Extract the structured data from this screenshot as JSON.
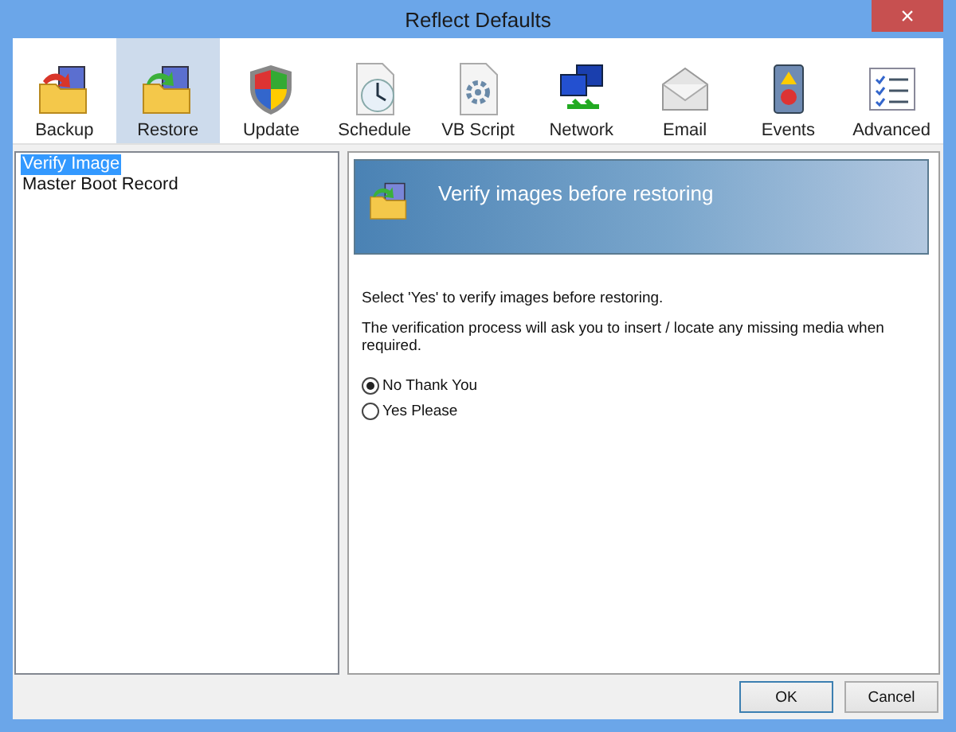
{
  "window": {
    "title": "Reflect Defaults",
    "close": "×"
  },
  "toolbar": [
    {
      "label": "Backup",
      "selected": false
    },
    {
      "label": "Restore",
      "selected": true
    },
    {
      "label": "Update",
      "selected": false
    },
    {
      "label": "Schedule",
      "selected": false
    },
    {
      "label": "VB Script",
      "selected": false
    },
    {
      "label": "Network",
      "selected": false
    },
    {
      "label": "Email",
      "selected": false
    },
    {
      "label": "Events",
      "selected": false
    },
    {
      "label": "Advanced",
      "selected": false
    }
  ],
  "sidebar": {
    "items": [
      {
        "label": "Verify Image",
        "selected": true
      },
      {
        "label": "Master Boot Record",
        "selected": false
      }
    ]
  },
  "panel": {
    "header": "Verify images before restoring",
    "paragraphs": [
      "Select 'Yes' to verify images before restoring.",
      "The verification process will ask you to insert / locate any missing media when required."
    ],
    "options": [
      {
        "label": "No Thank You",
        "selected": true
      },
      {
        "label": "Yes Please",
        "selected": false
      }
    ]
  },
  "buttons": [
    "OK",
    "Cancel"
  ]
}
